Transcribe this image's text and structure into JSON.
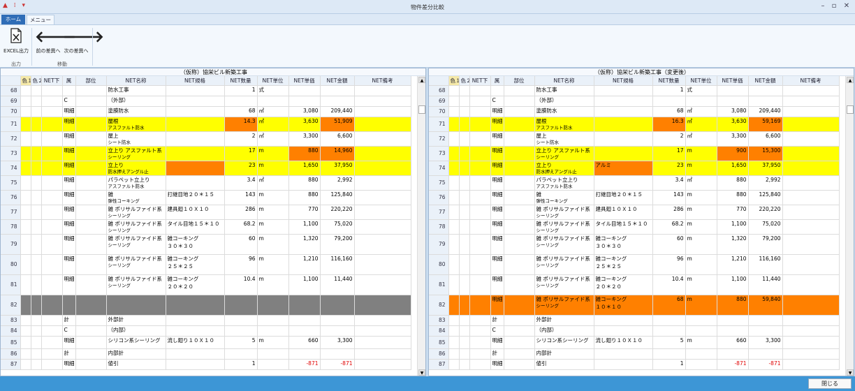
{
  "window": {
    "title": "物件差分比較",
    "qa_icons": "▲ ⁞ ▾"
  },
  "tabs": {
    "home": "ホーム",
    "menu": "メニュー"
  },
  "ribbon": {
    "excel_label": "EXCEL出力",
    "prev_label": "前の差異へ",
    "next_label": "次の差異へ",
    "group_output": "出力",
    "group_move": "移動"
  },
  "columns": [
    "色１",
    "色２",
    "NET下",
    "属",
    "部位",
    "NET名称",
    "NET規格",
    "NET数量",
    "NET単位",
    "NET単価",
    "NET金額",
    "NET備考"
  ],
  "left_panel": {
    "title": "（仮称）協栄ビル新築工事",
    "rows": [
      {
        "n": "68",
        "kind": "",
        "name": "防水工事",
        "name2": "",
        "spec": "",
        "spec2": "",
        "qty": "1",
        "unit": "式",
        "price": "",
        "amount": "",
        "cls": ""
      },
      {
        "n": "69",
        "kind": "C",
        "name": "（外部）",
        "name2": "",
        "spec": "",
        "spec2": "",
        "qty": "",
        "unit": "",
        "price": "",
        "amount": "",
        "cls": ""
      },
      {
        "n": "70",
        "kind": "明細",
        "name": "塗膜防水",
        "name2": "",
        "spec": "",
        "spec2": "",
        "qty": "68",
        "unit": "㎡",
        "price": "3,080",
        "amount": "209,440",
        "cls": ""
      },
      {
        "n": "71",
        "kind": "明細",
        "name": "屋根",
        "name2": "アスファルト防水",
        "spec": "",
        "spec2": "",
        "qty": "14.3",
        "unit": "㎡",
        "price": "3,630",
        "amount": "51,909",
        "cls": "y",
        "oc": [
          "qty",
          "amount"
        ]
      },
      {
        "n": "72",
        "kind": "明細",
        "name": "屋上",
        "name2": "シート防水",
        "spec": "",
        "spec2": "",
        "qty": "2",
        "unit": "㎡",
        "price": "3,300",
        "amount": "6,600",
        "cls": ""
      },
      {
        "n": "73",
        "kind": "明細",
        "name": "立上り アスファルト系",
        "name2": "シーリング",
        "spec": "",
        "spec2": "",
        "qty": "17",
        "unit": "m",
        "price": "880",
        "amount": "14,960",
        "cls": "y",
        "oc": [
          "price",
          "amount"
        ]
      },
      {
        "n": "74",
        "kind": "明細",
        "name": "立上り",
        "name2": "防水押えアングル止",
        "spec": "",
        "spec2": "",
        "qty": "23",
        "unit": "m",
        "price": "1,650",
        "amount": "37,950",
        "cls": "y",
        "oc": [
          "spec"
        ]
      },
      {
        "n": "75",
        "kind": "明細",
        "name": "パラペット立上り",
        "name2": "アスファルト防水",
        "spec": "",
        "spec2": "",
        "qty": "3.4",
        "unit": "㎡",
        "price": "880",
        "amount": "2,992",
        "cls": ""
      },
      {
        "n": "76",
        "kind": "明細",
        "name": "雑",
        "name2": "弾性コーキング",
        "spec": "打継目地２０＊１５",
        "spec2": "",
        "qty": "143",
        "unit": "m",
        "price": "880",
        "amount": "125,840",
        "cls": ""
      },
      {
        "n": "77",
        "kind": "明細",
        "name": "雑 ポリサルファイド系",
        "name2": "シーリング",
        "spec": "建具廻１０Ｘ１０",
        "spec2": "",
        "qty": "286",
        "unit": "m",
        "price": "770",
        "amount": "220,220",
        "cls": ""
      },
      {
        "n": "78",
        "kind": "明細",
        "name": "雑 ポリサルファイド系",
        "name2": "シーリング",
        "spec": "タイル目地１５＊１０",
        "spec2": "",
        "qty": "68.2",
        "unit": "m",
        "price": "1,100",
        "amount": "75,020",
        "cls": ""
      },
      {
        "n": "79",
        "kind": "明細",
        "name": "雑 ポリサルファイド系",
        "name2": "シーリング",
        "spec": "雑コーキング",
        "spec2": "３０＊３０",
        "qty": "60",
        "unit": "m",
        "price": "1,320",
        "amount": "79,200",
        "cls": "",
        "tall": true
      },
      {
        "n": "80",
        "kind": "明細",
        "name": "雑 ポリサルファイド系",
        "name2": "シーリング",
        "spec": "雑コーキング",
        "spec2": "２５＊２５",
        "qty": "96",
        "unit": "m",
        "price": "1,210",
        "amount": "116,160",
        "cls": "",
        "tall": true
      },
      {
        "n": "81",
        "kind": "明細",
        "name": "雑 ポリサルファイド系",
        "name2": "シーリング",
        "spec": "雑コーキング",
        "spec2": "２０＊２０",
        "qty": "10.4",
        "unit": "m",
        "price": "1,100",
        "amount": "11,440",
        "cls": "",
        "tall": true
      },
      {
        "n": "82",
        "kind": "",
        "name": "",
        "name2": "",
        "spec": "",
        "spec2": "",
        "qty": "",
        "unit": "",
        "price": "",
        "amount": "",
        "cls": "g",
        "tall": true
      },
      {
        "n": "83",
        "kind": "計",
        "name": "外部計",
        "name2": "",
        "spec": "",
        "spec2": "",
        "qty": "",
        "unit": "",
        "price": "",
        "amount": "",
        "cls": ""
      },
      {
        "n": "84",
        "kind": "C",
        "name": "（内部）",
        "name2": "",
        "spec": "",
        "spec2": "",
        "qty": "",
        "unit": "",
        "price": "",
        "amount": "",
        "cls": ""
      },
      {
        "n": "85",
        "kind": "明細",
        "name": "シリコン系シーリング",
        "name2": "",
        "spec": "流し廻り１０Ｘ１０",
        "spec2": "",
        "qty": "5",
        "unit": "m",
        "price": "660",
        "amount": "3,300",
        "cls": "",
        "mid": true
      },
      {
        "n": "86",
        "kind": "計",
        "name": "内部計",
        "name2": "",
        "spec": "",
        "spec2": "",
        "qty": "",
        "unit": "",
        "price": "",
        "amount": "",
        "cls": ""
      },
      {
        "n": "87",
        "kind": "明細",
        "name": "値引",
        "name2": "",
        "spec": "",
        "spec2": "",
        "qty": "1",
        "unit": "",
        "price": "-871",
        "amount": "-871",
        "cls": "",
        "neg": true
      }
    ]
  },
  "right_panel": {
    "title": "（仮称）協栄ビル新築工事（変更後）",
    "rows": [
      {
        "n": "68",
        "kind": "",
        "name": "防水工事",
        "name2": "",
        "spec": "",
        "spec2": "",
        "qty": "1",
        "unit": "式",
        "price": "",
        "amount": "",
        "cls": ""
      },
      {
        "n": "69",
        "kind": "C",
        "name": "（外部）",
        "name2": "",
        "spec": "",
        "spec2": "",
        "qty": "",
        "unit": "",
        "price": "",
        "amount": "",
        "cls": ""
      },
      {
        "n": "70",
        "kind": "明細",
        "name": "塗膜防水",
        "name2": "",
        "spec": "",
        "spec2": "",
        "qty": "68",
        "unit": "㎡",
        "price": "3,080",
        "amount": "209,440",
        "cls": ""
      },
      {
        "n": "71",
        "kind": "明細",
        "name": "屋根",
        "name2": "アスファルト防水",
        "spec": "",
        "spec2": "",
        "qty": "16.3",
        "unit": "㎡",
        "price": "3,630",
        "amount": "59,169",
        "cls": "y",
        "oc": [
          "qty",
          "amount"
        ]
      },
      {
        "n": "72",
        "kind": "明細",
        "name": "屋上",
        "name2": "シート防水",
        "spec": "",
        "spec2": "",
        "qty": "2",
        "unit": "㎡",
        "price": "3,300",
        "amount": "6,600",
        "cls": ""
      },
      {
        "n": "73",
        "kind": "明細",
        "name": "立上り アスファルト系",
        "name2": "シーリング",
        "spec": "",
        "spec2": "",
        "qty": "17",
        "unit": "m",
        "price": "900",
        "amount": "15,300",
        "cls": "y",
        "oc": [
          "price",
          "amount"
        ]
      },
      {
        "n": "74",
        "kind": "明細",
        "name": "立上り",
        "name2": "防水押えアングル止",
        "spec": "アルミ",
        "spec2": "",
        "qty": "23",
        "unit": "m",
        "price": "1,650",
        "amount": "37,950",
        "cls": "y",
        "oc": [
          "spec"
        ]
      },
      {
        "n": "75",
        "kind": "明細",
        "name": "パラペット立上り",
        "name2": "アスファルト防水",
        "spec": "",
        "spec2": "",
        "qty": "3.4",
        "unit": "㎡",
        "price": "880",
        "amount": "2,992",
        "cls": ""
      },
      {
        "n": "76",
        "kind": "明細",
        "name": "雑",
        "name2": "弾性コーキング",
        "spec": "打継目地２０＊１５",
        "spec2": "",
        "qty": "143",
        "unit": "m",
        "price": "880",
        "amount": "125,840",
        "cls": ""
      },
      {
        "n": "77",
        "kind": "明細",
        "name": "雑 ポリサルファイド系",
        "name2": "シーリング",
        "spec": "建具廻１０Ｘ１０",
        "spec2": "",
        "qty": "286",
        "unit": "m",
        "price": "770",
        "amount": "220,220",
        "cls": ""
      },
      {
        "n": "78",
        "kind": "明細",
        "name": "雑 ポリサルファイド系",
        "name2": "シーリング",
        "spec": "タイル目地１５＊１０",
        "spec2": "",
        "qty": "68.2",
        "unit": "m",
        "price": "1,100",
        "amount": "75,020",
        "cls": ""
      },
      {
        "n": "79",
        "kind": "明細",
        "name": "雑 ポリサルファイド系",
        "name2": "シーリング",
        "spec": "雑コーキング",
        "spec2": "３０＊３０",
        "qty": "60",
        "unit": "m",
        "price": "1,320",
        "amount": "79,200",
        "cls": "",
        "tall": true
      },
      {
        "n": "80",
        "kind": "明細",
        "name": "雑 ポリサルファイド系",
        "name2": "シーリング",
        "spec": "雑コーキング",
        "spec2": "２５＊２５",
        "qty": "96",
        "unit": "m",
        "price": "1,210",
        "amount": "116,160",
        "cls": "",
        "tall": true
      },
      {
        "n": "81",
        "kind": "明細",
        "name": "雑 ポリサルファイド系",
        "name2": "シーリング",
        "spec": "雑コーキング",
        "spec2": "２０＊２０",
        "qty": "10.4",
        "unit": "m",
        "price": "1,100",
        "amount": "11,440",
        "cls": "",
        "tall": true
      },
      {
        "n": "82",
        "kind": "明細",
        "name": "雑 ポリサルファイド系",
        "name2": "シーリング",
        "spec": "雑コーキング",
        "spec2": "１０＊１０",
        "qty": "68",
        "unit": "m",
        "price": "880",
        "amount": "59,840",
        "cls": "o",
        "tall": true
      },
      {
        "n": "83",
        "kind": "計",
        "name": "外部計",
        "name2": "",
        "spec": "",
        "spec2": "",
        "qty": "",
        "unit": "",
        "price": "",
        "amount": "",
        "cls": ""
      },
      {
        "n": "84",
        "kind": "C",
        "name": "（内部）",
        "name2": "",
        "spec": "",
        "spec2": "",
        "qty": "",
        "unit": "",
        "price": "",
        "amount": "",
        "cls": ""
      },
      {
        "n": "85",
        "kind": "明細",
        "name": "シリコン系シーリング",
        "name2": "",
        "spec": "流し廻り１０Ｘ１０",
        "spec2": "",
        "qty": "5",
        "unit": "m",
        "price": "660",
        "amount": "3,300",
        "cls": "",
        "mid": true
      },
      {
        "n": "86",
        "kind": "計",
        "name": "内部計",
        "name2": "",
        "spec": "",
        "spec2": "",
        "qty": "",
        "unit": "",
        "price": "",
        "amount": "",
        "cls": ""
      },
      {
        "n": "87",
        "kind": "明細",
        "name": "値引",
        "name2": "",
        "spec": "",
        "spec2": "",
        "qty": "1",
        "unit": "",
        "price": "-871",
        "amount": "-871",
        "cls": "",
        "neg": true
      }
    ]
  },
  "footer": {
    "close_label": "閉じる"
  },
  "colors": {
    "diff_row": "#ffff00",
    "diff_cell": "#ff8000",
    "removed_row": "#808080",
    "status_bar": "#3d96d6"
  }
}
